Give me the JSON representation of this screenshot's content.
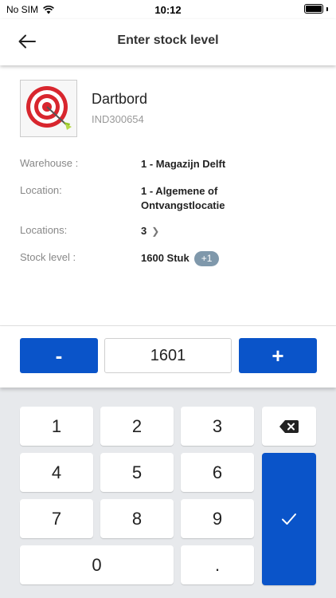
{
  "status_bar": {
    "carrier": "No SIM",
    "time": "10:12"
  },
  "header": {
    "title": "Enter stock level"
  },
  "product": {
    "name": "Dartbord",
    "code": "IND300654"
  },
  "details": {
    "warehouse_label": "Warehouse :",
    "warehouse_value": "1 - Magazijn Delft",
    "location_label": "Location:",
    "location_value_line1": "1 - Algemene of",
    "location_value_line2": "Ontvangstlocatie",
    "locations_label": "Locations:",
    "locations_value": "3",
    "stock_label": "Stock level :",
    "stock_value": "1600 Stuk",
    "stock_delta": "+1"
  },
  "quantity": {
    "minus_label": "-",
    "plus_label": "+",
    "value": "1601"
  },
  "keypad": {
    "keys": [
      "1",
      "2",
      "3",
      "4",
      "5",
      "6",
      "7",
      "8",
      "9",
      "0",
      "."
    ]
  },
  "colors": {
    "accent": "#0a54c9",
    "badge": "#7f98ab",
    "keypad_bg": "#e7e9ec"
  }
}
